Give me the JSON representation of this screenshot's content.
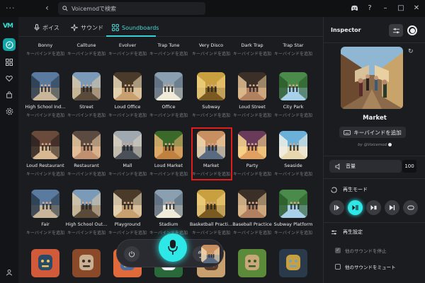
{
  "titlebar": {
    "menu_glyph": "···",
    "back_glyph": "‹",
    "search_placeholder": "Voicemodで検索",
    "help_glyph": "?",
    "minimize_glyph": "–",
    "maximize_glyph": "□",
    "close_glyph": "✕"
  },
  "rail": {
    "logo": "VM",
    "items": [
      "voicemod-home-icon",
      "grid-icon",
      "heart-icon",
      "bag-icon",
      "settings-icon",
      "user-icon"
    ]
  },
  "tabs": [
    {
      "label": "ボイス",
      "icon": "mic-icon"
    },
    {
      "label": "サウンド",
      "icon": "sparkle-icon"
    },
    {
      "label": "Soundboards",
      "icon": "grid-icon",
      "active": true
    }
  ],
  "keybind_label": "キーバインドを追加",
  "sounds_top": [
    "Bonny",
    "Calltune",
    "Evolver",
    "Trap Tune",
    "Very Disco",
    "Dark Trap",
    "Trap Star"
  ],
  "sounds": [
    [
      "High School Ind...",
      "Street",
      "Loud Office",
      "Office",
      "Subway",
      "Loud Street",
      "City Park"
    ],
    [
      "Loud Restaurant",
      "Restaurant",
      "Mall",
      "Loud Market",
      "Market",
      "Party",
      "Seaside"
    ],
    [
      "Fair",
      "High School Out...",
      "Playground",
      "Stadium",
      "Basketball Practi...",
      "Baseball Practice",
      "Subway Platform"
    ]
  ],
  "selected_sound": "Market",
  "inspector": {
    "title": "Inspector",
    "sound_name": "Market",
    "keybind_button": "キーバインドを追加",
    "author": "by @Voicemod",
    "volume_label": "音量",
    "volume_value": "100",
    "play_mode_label": "再生モード",
    "play_settings_label": "再生設定",
    "stop_other_label": "他のサウンドを停止",
    "stop_other_checked": true,
    "mute_other_label": "他のサウンドをミュート",
    "mute_other_checked": false
  },
  "colors": {
    "accent": "#2ee8e8",
    "highlight": "#e21b1b",
    "background": "#17181c"
  }
}
